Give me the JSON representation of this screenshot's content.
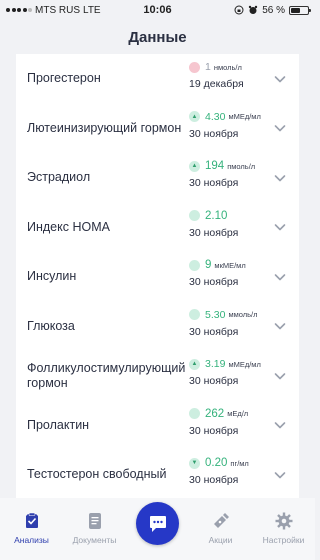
{
  "status_bar": {
    "carrier": "MTS RUS",
    "network": "LTE",
    "time": "10:06",
    "battery": "56 %",
    "battery_level": 0.56
  },
  "header": {
    "title": "Данные"
  },
  "rows": [
    {
      "name": "Прогестерон",
      "value": "1",
      "unit": "нмоль/л",
      "date": "19 декабря",
      "status": "pink",
      "arrow": "",
      "value_size": "small"
    },
    {
      "name": "Лютеинизирующий гормон",
      "value": "4.30",
      "unit": "мМЕд/мл",
      "date": "30 ноября",
      "status": "green",
      "arrow": "▲",
      "value_size": "small"
    },
    {
      "name": "Эстрадиол",
      "value": "194",
      "unit": "пмоль/л",
      "date": "30 ноября",
      "status": "green",
      "arrow": "▲",
      "value_size": "big"
    },
    {
      "name": "Индекс HOMA",
      "value": "2.10",
      "unit": "",
      "date": "30 ноября",
      "status": "green",
      "arrow": "",
      "value_size": "big"
    },
    {
      "name": "Инсулин",
      "value": "9",
      "unit": "мкМЕ/мл",
      "date": "30 ноября",
      "status": "green",
      "arrow": "",
      "value_size": "big"
    },
    {
      "name": "Глюкоза",
      "value": "5.30",
      "unit": "ммоль/л",
      "date": "30 ноября",
      "status": "green",
      "arrow": "",
      "value_size": "small"
    },
    {
      "name": "Фолликулостимулирующий гормон",
      "value": "3.19",
      "unit": "мМЕд/мл",
      "date": "30 ноября",
      "status": "green",
      "arrow": "▲",
      "value_size": "small"
    },
    {
      "name": "Пролактин",
      "value": "262",
      "unit": "мЕд/л",
      "date": "30 ноября",
      "status": "green",
      "arrow": "",
      "value_size": "big"
    },
    {
      "name": "Тестостерон свободный",
      "value": "0.20",
      "unit": "пг/мл",
      "date": "30 ноября",
      "status": "green",
      "arrow": "▼",
      "value_size": "big"
    }
  ],
  "tabs": [
    {
      "label": "Анализы",
      "icon": "analyses-icon",
      "active": true
    },
    {
      "label": "Документы",
      "icon": "documents-icon",
      "active": false
    },
    {
      "label": "",
      "icon": "chat-icon",
      "active": false
    },
    {
      "label": "Акции",
      "icon": "promotions-icon",
      "active": false
    },
    {
      "label": "Настройки",
      "icon": "settings-icon",
      "active": false
    }
  ],
  "colors": {
    "accent": "#2638c7",
    "active_tab": "#2f3fae",
    "normal_value": "#35b27c",
    "normal_dot": "#cdeee0",
    "alert_dot": "#f6c6cf",
    "chevron": "#9aa0ad"
  }
}
